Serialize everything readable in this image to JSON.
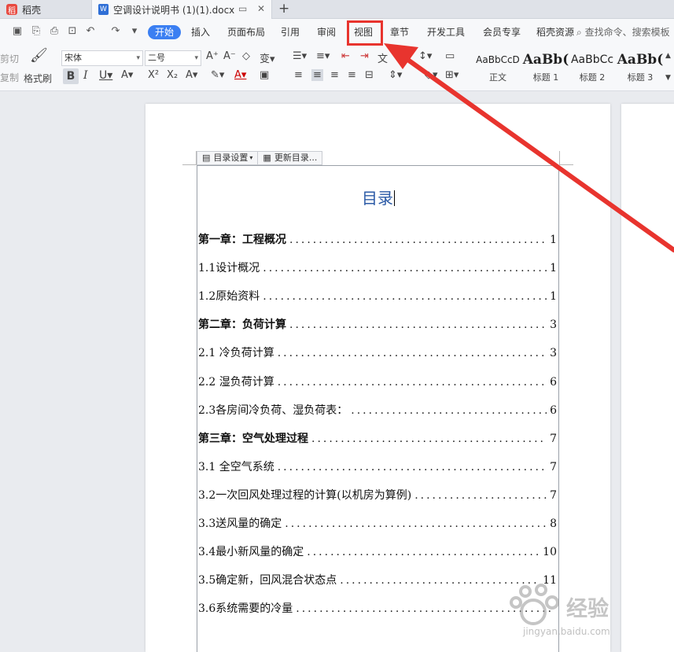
{
  "tabs": {
    "home_label": "稻壳",
    "doc_label": "空调设计说明书 (1)(1).docx",
    "new_tab": "+",
    "close_glyph": "✕"
  },
  "menu": {
    "items": [
      "开始",
      "插入",
      "页面布局",
      "引用",
      "审阅",
      "视图",
      "章节",
      "开发工具",
      "会员专享",
      "稻壳资源"
    ],
    "active": "开始",
    "highlighted": "视图",
    "search_label": "查找命令、搜索模板"
  },
  "ribbon": {
    "cut_label": "剪切",
    "copy_label": "复制",
    "format_painter_label": "格式刷",
    "font_name": "宋体",
    "font_size": "二号",
    "styles": [
      {
        "sample": "AaBbCcD",
        "name": "正文"
      },
      {
        "sample": "AaBb(",
        "name": "标题 1"
      },
      {
        "sample": "AaBbCc",
        "name": "标题 2"
      },
      {
        "sample": "AaBb(",
        "name": "标题 3"
      }
    ]
  },
  "toc_toolbar": {
    "settings_label": "目录设置",
    "update_label": "更新目录..."
  },
  "document": {
    "toc_title": "目录",
    "entries": [
      {
        "text": "第一章：工程概况",
        "page": "1",
        "chapter": true
      },
      {
        "text": "1.1设计概况",
        "page": "1",
        "chapter": false
      },
      {
        "text": "1.2原始资料",
        "page": "1",
        "chapter": false
      },
      {
        "text": "第二章：负荷计算",
        "page": "3",
        "chapter": true
      },
      {
        "text": "2.1 冷负荷计算",
        "page": "3",
        "chapter": false
      },
      {
        "text": "2.2 湿负荷计算",
        "page": "6",
        "chapter": false
      },
      {
        "text": "2.3各房间冷负荷、湿负荷表：",
        "page": "6",
        "chapter": false
      },
      {
        "text": "第三章：空气处理过程",
        "page": "7",
        "chapter": true
      },
      {
        "text": "3.1 全空气系统",
        "page": "7",
        "chapter": false
      },
      {
        "text": "3.2一次回风处理过程的计算(以机房为算例)",
        "page": "7",
        "chapter": false
      },
      {
        "text": "3.3送风量的确定",
        "page": "8",
        "chapter": false
      },
      {
        "text": "3.4最小新风量的确定",
        "page": "10",
        "chapter": false
      },
      {
        "text": "3.5确定新，回风混合状态点",
        "page": "11",
        "chapter": false
      },
      {
        "text": "3.6系统需要的冷量",
        "page": "",
        "chapter": false
      }
    ]
  },
  "watermark": {
    "brand": "经验",
    "url": "jingyan.baidu.com"
  },
  "colors": {
    "accent": "#3b7ff2",
    "annotation": "#e8342e",
    "toc_title": "#2b5aa6"
  }
}
